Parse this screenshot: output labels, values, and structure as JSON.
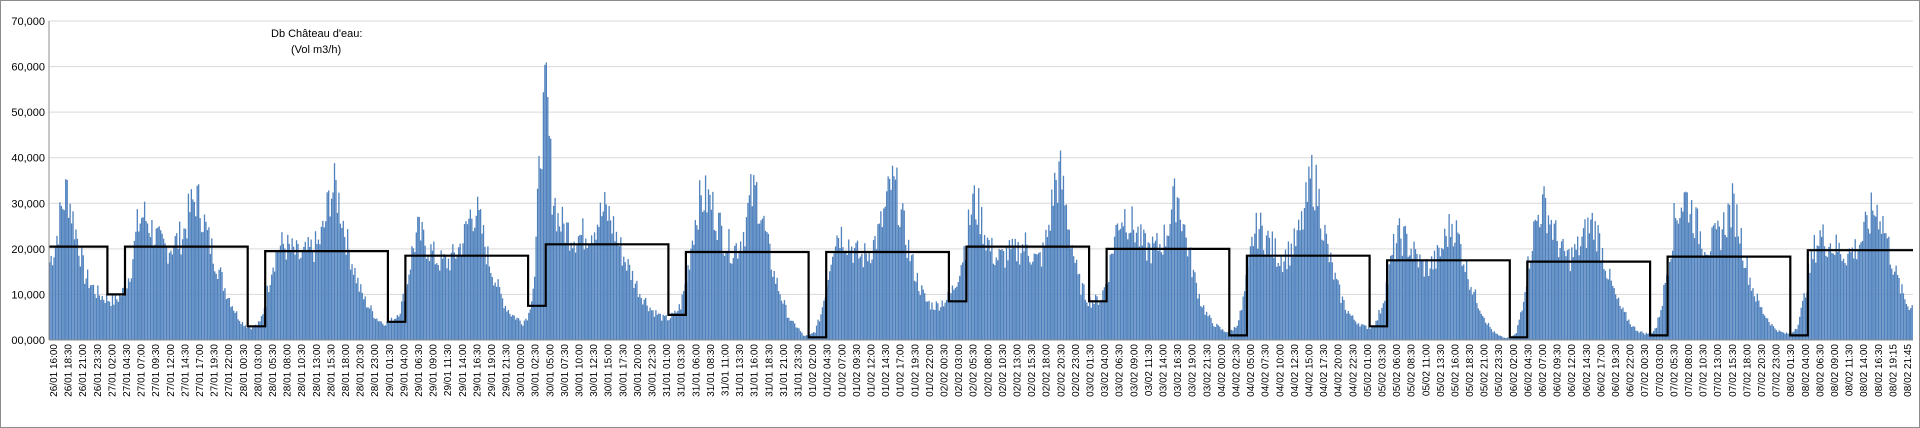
{
  "colors": {
    "bars": "#4f81bd",
    "baseline": "#000000",
    "grid": "#d9d9d9",
    "axis": "#8c8c8c"
  },
  "chart_data": {
    "type": "bar",
    "title": "Db  Château d'eau:",
    "subtitle": "(Vol m3/h)",
    "xlabel": "",
    "ylabel": "",
    "ylim": [
      0,
      70000
    ],
    "grid": true,
    "legend": "none",
    "y_tick_labels": [
      "00,000",
      "10,000",
      "20,000",
      "30,000",
      "40,000",
      "50,000",
      "60,000",
      "70,000"
    ],
    "x_tick_labels": [
      "26/01 16:00",
      "26/01 18:30",
      "26/01 21:00",
      "26/01 23:30",
      "27/01 02:00",
      "27/01 04:30",
      "27/01 07:00",
      "27/01 09:30",
      "27/01 12:00",
      "27/01 14:30",
      "27/01 17:00",
      "27/01 19:30",
      "27/01 22:00",
      "28/01 00:30",
      "28/01 03:00",
      "28/01 05:30",
      "28/01 08:00",
      "28/01 10:30",
      "28/01 13:00",
      "28/01 15:30",
      "28/01 18:00",
      "28/01 20:30",
      "28/01 23:00",
      "29/01 01:30",
      "29/01 04:00",
      "29/01 06:30",
      "29/01 09:00",
      "29/01 11:30",
      "29/01 14:00",
      "29/01 16:30",
      "29/01 19:00",
      "29/01 21:30",
      "30/01 00:00",
      "30/01 02:30",
      "30/01 05:00",
      "30/01 07:30",
      "30/01 10:00",
      "30/01 12:30",
      "30/01 15:00",
      "30/01 17:30",
      "30/01 20:00",
      "30/01 22:30",
      "31/01 01:00",
      "31/01 03:30",
      "31/01 06:00",
      "31/01 08:30",
      "31/01 11:00",
      "31/01 13:30",
      "31/01 16:00",
      "31/01 18:30",
      "31/01 21:00",
      "31/01 23:30",
      "01/02 02:00",
      "01/02 04:30",
      "01/02 07:00",
      "01/02 09:30",
      "01/02 12:00",
      "01/02 14:30",
      "01/02 17:00",
      "01/02 19:30",
      "01/02 22:00",
      "02/02 00:30",
      "02/02 03:00",
      "02/02 05:30",
      "02/02 08:00",
      "02/02 10:30",
      "02/02 13:00",
      "02/02 15:30",
      "02/02 18:00",
      "02/02 20:30",
      "02/02 23:00",
      "03/02 01:30",
      "03/02 04:00",
      "03/02 06:30",
      "03/02 09:00",
      "03/02 11:30",
      "03/02 14:00",
      "03/02 16:30",
      "03/02 19:00",
      "03/02 21:30",
      "04/02 00:00",
      "04/02 02:30",
      "04/02 05:00",
      "04/02 07:30",
      "04/02 10:00",
      "04/02 12:30",
      "04/02 15:00",
      "04/02 17:30",
      "04/02 20:00",
      "04/02 22:30",
      "05/02 01:00",
      "05/02 03:30",
      "05/02 06:00",
      "05/02 08:30",
      "05/02 11:00",
      "05/02 13:30",
      "05/02 16:00",
      "05/02 18:30",
      "05/02 21:00",
      "05/02 23:30",
      "06/02 02:00",
      "06/02 04:30",
      "06/02 07:00",
      "06/02 09:30",
      "06/02 12:00",
      "06/02 14:30",
      "06/02 17:00",
      "06/02 19:30",
      "06/02 22:00",
      "07/02 00:30",
      "07/02 03:00",
      "07/02 05:30",
      "07/02 08:00",
      "07/02 10:30",
      "07/02 13:00",
      "07/02 15:30",
      "07/02 18:00",
      "07/02 20:30",
      "07/02 23:00",
      "08/02 01:30",
      "08/02 04:00",
      "08/02 06:30",
      "08/02 09:00",
      "08/02 11:30",
      "08/02 14:00",
      "08/02 16:30",
      "08/02 19:15",
      "08/02 21:45"
    ],
    "x_start": "26/01 16:00",
    "x_end": "08/02 23:00",
    "samples_per_hour": 4,
    "series": [
      {
        "kind": "bars",
        "profile_per_hour": [
          {
            "day": "26/01",
            "values": [
              18000,
              22000,
              30000,
              35000,
              28000,
              22000,
              15000,
              13000
            ]
          },
          {
            "day": "27/01",
            "values": [
              11000,
              10000,
              9500,
              9000,
              10000,
              12000,
              17000,
              26000,
              29000,
              27000,
              24000,
              22000,
              21000,
              22000,
              23000,
              25000,
              30000,
              33000,
              30000,
              24000,
              20000,
              16000,
              12000,
              9000
            ]
          },
          {
            "day": "28/01",
            "values": [
              6000,
              4000,
              3000,
              3000,
              4000,
              9000,
              17000,
              21000,
              22000,
              21000,
              20000,
              19000,
              20000,
              21000,
              22000,
              26000,
              34000,
              35000,
              29000,
              22000,
              17000,
              12000,
              9000,
              7000
            ]
          },
          {
            "day": "29/01",
            "values": [
              5000,
              4000,
              4000,
              5000,
              7000,
              12000,
              20000,
              25000,
              23000,
              21000,
              19000,
              18000,
              18000,
              19000,
              21000,
              24000,
              29000,
              30000,
              25000,
              19000,
              15000,
              11000,
              8000,
              6000
            ]
          },
          {
            "day": "30/01",
            "values": [
              5000,
              4000,
              6000,
              15000,
              45000,
              57000,
              35000,
              28000,
              26000,
              25000,
              24000,
              24000,
              25000,
              26000,
              28000,
              30000,
              28000,
              24000,
              20000,
              17000,
              14000,
              11000,
              9000,
              7000
            ]
          },
          {
            "day": "31/01",
            "values": [
              6000,
              5000,
              5000,
              6000,
              8000,
              14000,
              24000,
              31000,
              33000,
              32000,
              29000,
              25000,
              22000,
              21000,
              22000,
              26000,
              33000,
              34000,
              28000,
              21000,
              15000,
              11000,
              7000,
              4000
            ]
          },
          {
            "day": "01/02",
            "values": [
              3000,
              1000,
              1000,
              2000,
              6000,
              13000,
              22000,
              25000,
              24000,
              22000,
              20000,
              19000,
              20000,
              22000,
              25000,
              30000,
              36000,
              34000,
              27000,
              21000,
              16000,
              12000,
              9000,
              8000
            ]
          },
          {
            "day": "02/02",
            "values": [
              8000,
              9000,
              10000,
              13000,
              18000,
              24000,
              32000,
              30000,
              25000,
              21000,
              19000,
              19000,
              20000,
              20000,
              21000,
              22000,
              20000,
              18000,
              20000,
              26000,
              36000,
              38000,
              30000,
              22000
            ]
          },
          {
            "day": "03/02",
            "values": [
              14000,
              11000,
              9000,
              9000,
              10000,
              14000,
              22000,
              28000,
              29000,
              27000,
              25000,
              22000,
              21000,
              21000,
              22000,
              24000,
              30000,
              34000,
              27000,
              20000,
              14000,
              9000,
              6000,
              4000
            ]
          },
          {
            "day": "04/02",
            "values": [
              3000,
              2000,
              2000,
              3000,
              7000,
              15000,
              24000,
              26000,
              24000,
              22000,
              20000,
              19000,
              20000,
              22000,
              25000,
              31000,
              38000,
              34000,
              26000,
              19000,
              14000,
              10000,
              7000,
              5000
            ]
          },
          {
            "day": "05/02",
            "values": [
              4000,
              3000,
              3000,
              4000,
              8000,
              14000,
              21000,
              24000,
              23000,
              21000,
              19000,
              17000,
              17000,
              18000,
              20000,
              24000,
              27000,
              24000,
              19000,
              14000,
              10000,
              7000,
              4000,
              2000
            ]
          },
          {
            "day": "06/02",
            "values": [
              1000,
              500,
              500,
              1500,
              8000,
              17000,
              25000,
              30000,
              31000,
              27000,
              23000,
              20000,
              19000,
              20000,
              22000,
              25000,
              27000,
              24000,
              19000,
              14000,
              10000,
              7000,
              5000,
              3000
            ]
          },
          {
            "day": "07/02",
            "values": [
              2000,
              1500,
              1500,
              3000,
              9000,
              18000,
              27000,
              31000,
              33000,
              30000,
              26000,
              23000,
              22000,
              23000,
              25000,
              28000,
              31000,
              27000,
              20000,
              14000,
              10000,
              7000,
              5000,
              3000
            ]
          },
          {
            "day": "08/02",
            "values": [
              2000,
              1500,
              1500,
              3000,
              8000,
              15000,
              21000,
              24000,
              23000,
              22000,
              21000,
              20000,
              20000,
              21000,
              23000,
              26000,
              30000,
              30000,
              26000,
              20000,
              15000,
              11000,
              8000
            ]
          }
        ]
      },
      {
        "kind": "step",
        "segments": [
          {
            "from": "26/01 16:00",
            "to": "27/01 02:00",
            "value": 20500
          },
          {
            "from": "27/01 02:00",
            "to": "27/01 05:00",
            "value": 10000
          },
          {
            "from": "27/01 05:00",
            "to": "28/01 02:00",
            "value": 20500
          },
          {
            "from": "28/01 02:00",
            "to": "28/01 05:00",
            "value": 3000
          },
          {
            "from": "28/01 05:00",
            "to": "29/01 02:00",
            "value": 19500
          },
          {
            "from": "29/01 02:00",
            "to": "29/01 05:00",
            "value": 4000
          },
          {
            "from": "29/01 05:00",
            "to": "30/01 02:00",
            "value": 18500
          },
          {
            "from": "30/01 02:00",
            "to": "30/01 05:00",
            "value": 7500
          },
          {
            "from": "30/01 05:00",
            "to": "31/01 02:00",
            "value": 21000
          },
          {
            "from": "31/01 02:00",
            "to": "31/01 05:00",
            "value": 5500
          },
          {
            "from": "31/01 05:00",
            "to": "01/02 02:00",
            "value": 19300
          },
          {
            "from": "01/02 02:00",
            "to": "01/02 05:00",
            "value": 600
          },
          {
            "from": "01/02 05:00",
            "to": "02/02 02:00",
            "value": 19300
          },
          {
            "from": "02/02 02:00",
            "to": "02/02 05:00",
            "value": 8500
          },
          {
            "from": "02/02 05:00",
            "to": "03/02 02:00",
            "value": 20500
          },
          {
            "from": "03/02 02:00",
            "to": "03/02 05:00",
            "value": 8500
          },
          {
            "from": "03/02 05:00",
            "to": "04/02 02:00",
            "value": 20000
          },
          {
            "from": "04/02 02:00",
            "to": "04/02 05:00",
            "value": 1000
          },
          {
            "from": "04/02 05:00",
            "to": "05/02 02:00",
            "value": 18500
          },
          {
            "from": "05/02 02:00",
            "to": "05/02 05:00",
            "value": 3000
          },
          {
            "from": "05/02 05:00",
            "to": "06/02 02:00",
            "value": 17500
          },
          {
            "from": "06/02 02:00",
            "to": "06/02 05:00",
            "value": 600
          },
          {
            "from": "06/02 05:00",
            "to": "07/02 02:00",
            "value": 17200
          },
          {
            "from": "07/02 02:00",
            "to": "07/02 05:00",
            "value": 1000
          },
          {
            "from": "07/02 05:00",
            "to": "08/02 02:00",
            "value": 18300
          },
          {
            "from": "08/02 02:00",
            "to": "08/02 05:00",
            "value": 1000
          },
          {
            "from": "08/02 05:00",
            "to": "08/02 23:00",
            "value": 19700
          }
        ]
      }
    ]
  }
}
